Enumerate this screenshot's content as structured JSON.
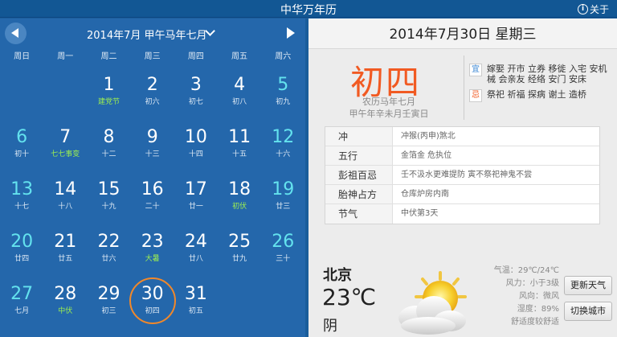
{
  "titlebar": {
    "title": "中华万年历",
    "about": "关于"
  },
  "calendar": {
    "month_title": "2014年7月  甲午马年七月",
    "weekdays": [
      "周日",
      "周一",
      "周二",
      "周三",
      "周四",
      "周五",
      "周六"
    ],
    "days": [
      {
        "day": "1",
        "lunar": "建党节"
      },
      {
        "day": "2",
        "lunar": "初六"
      },
      {
        "day": "3",
        "lunar": "初七"
      },
      {
        "day": "4",
        "lunar": "初八"
      },
      {
        "day": "5",
        "lunar": "初九"
      },
      {
        "day": "6",
        "lunar": "初十"
      },
      {
        "day": "7",
        "lunar": "七七事变"
      },
      {
        "day": "8",
        "lunar": "十二"
      },
      {
        "day": "9",
        "lunar": "十三"
      },
      {
        "day": "10",
        "lunar": "十四"
      },
      {
        "day": "11",
        "lunar": "十五"
      },
      {
        "day": "12",
        "lunar": "十六"
      },
      {
        "day": "13",
        "lunar": "十七"
      },
      {
        "day": "14",
        "lunar": "十八"
      },
      {
        "day": "15",
        "lunar": "十九"
      },
      {
        "day": "16",
        "lunar": "二十"
      },
      {
        "day": "17",
        "lunar": "廿一"
      },
      {
        "day": "18",
        "lunar": "初伏"
      },
      {
        "day": "19",
        "lunar": "廿三"
      },
      {
        "day": "20",
        "lunar": "廿四"
      },
      {
        "day": "21",
        "lunar": "廿五"
      },
      {
        "day": "22",
        "lunar": "廿六"
      },
      {
        "day": "23",
        "lunar": "大暑"
      },
      {
        "day": "24",
        "lunar": "廿八"
      },
      {
        "day": "25",
        "lunar": "廿九"
      },
      {
        "day": "26",
        "lunar": "三十"
      },
      {
        "day": "27",
        "lunar": "七月"
      },
      {
        "day": "28",
        "lunar": "中伏"
      },
      {
        "day": "29",
        "lunar": "初三"
      },
      {
        "day": "30",
        "lunar": "初四"
      },
      {
        "day": "31",
        "lunar": "初五"
      }
    ],
    "festival_days": [
      1,
      7,
      18,
      23,
      28
    ],
    "selected_day": 30
  },
  "detail": {
    "date_header": "2014年7月30日  星期三",
    "big_lunar": "初四",
    "lunar_line1": "农历马年七月",
    "lunar_line2": "甲午年辛未月壬寅日",
    "yi_tag": "宜",
    "yi_text": "嫁娶 开市 立券 移徙 入宅 安机械 会亲友 经络 安门 安床",
    "ji_tag": "忌",
    "ji_text": "祭祀 祈福 探病 谢土 造桥",
    "rows": [
      {
        "key": "冲",
        "value": "冲猴(丙申)煞北"
      },
      {
        "key": "五行",
        "value": "金箔金 危执位"
      },
      {
        "key": "彭祖百忌",
        "value": "壬不汲水更难提防 寅不祭祀神鬼不尝"
      },
      {
        "key": "胎神占方",
        "value": "仓库炉房内南"
      },
      {
        "key": "节气",
        "value": "中伏第3天"
      }
    ]
  },
  "weather": {
    "city": "北京",
    "temp": "23℃",
    "condition": "阴",
    "stats": [
      "气温：29℃/24℃",
      "风力：小于3级",
      "风向：微风",
      "湿度：89%",
      "舒适度较舒适"
    ],
    "update_button": "更新天气",
    "switch_button": "切换城市"
  },
  "colors": {
    "accent": "#f15a22",
    "weekend": "#63e2ee",
    "festival": "#9ef04f",
    "panel": "#2467ab"
  }
}
